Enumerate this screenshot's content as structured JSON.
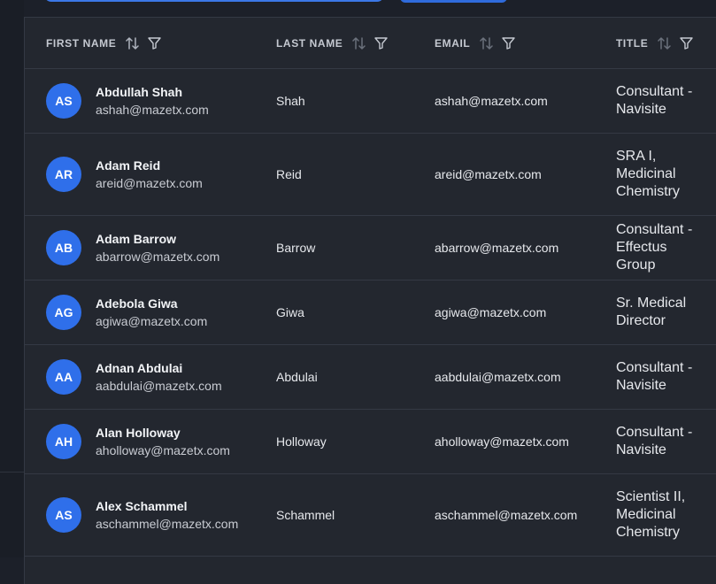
{
  "columns": [
    {
      "key": "first_name",
      "label": "FIRST NAME"
    },
    {
      "key": "last_name",
      "label": "LAST NAME"
    },
    {
      "key": "email",
      "label": "EMAIL"
    },
    {
      "key": "title",
      "label": "TITLE"
    }
  ],
  "icons": {
    "sort": "sort-arrows-icon",
    "filter": "filter-funnel-icon"
  },
  "colors": {
    "accent": "#2f6fea",
    "background": "#1c2029",
    "panel": "#23272f",
    "border": "#343944"
  },
  "rows": [
    {
      "initials": "AS",
      "name": "Abdullah Shah",
      "email": "ashah@mazetx.com",
      "last_name": "Shah",
      "title_lines": [
        "Consultant -",
        "Navisite"
      ]
    },
    {
      "initials": "AR",
      "name": "Adam Reid",
      "email": "areid@mazetx.com",
      "last_name": "Reid",
      "title_lines": [
        "SRA I,",
        "Medicinal",
        "Chemistry"
      ]
    },
    {
      "initials": "AB",
      "name": "Adam Barrow",
      "email": "abarrow@mazetx.com",
      "last_name": "Barrow",
      "title_lines": [
        "Consultant -",
        "Effectus Group"
      ]
    },
    {
      "initials": "AG",
      "name": "Adebola Giwa",
      "email": "agiwa@mazetx.com",
      "last_name": "Giwa",
      "title_lines": [
        "Sr. Medical",
        "Director"
      ]
    },
    {
      "initials": "AA",
      "name": "Adnan Abdulai",
      "email": "aabdulai@mazetx.com",
      "last_name": "Abdulai",
      "title_lines": [
        "Consultant -",
        "Navisite"
      ]
    },
    {
      "initials": "AH",
      "name": "Alan Holloway",
      "email": "aholloway@mazetx.com",
      "last_name": "Holloway",
      "title_lines": [
        "Consultant -",
        "Navisite"
      ]
    },
    {
      "initials": "AS",
      "name": "Alex Schammel",
      "email": "aschammel@mazetx.com",
      "last_name": "Schammel",
      "title_lines": [
        "Scientist II,",
        "Medicinal",
        "Chemistry"
      ]
    }
  ]
}
